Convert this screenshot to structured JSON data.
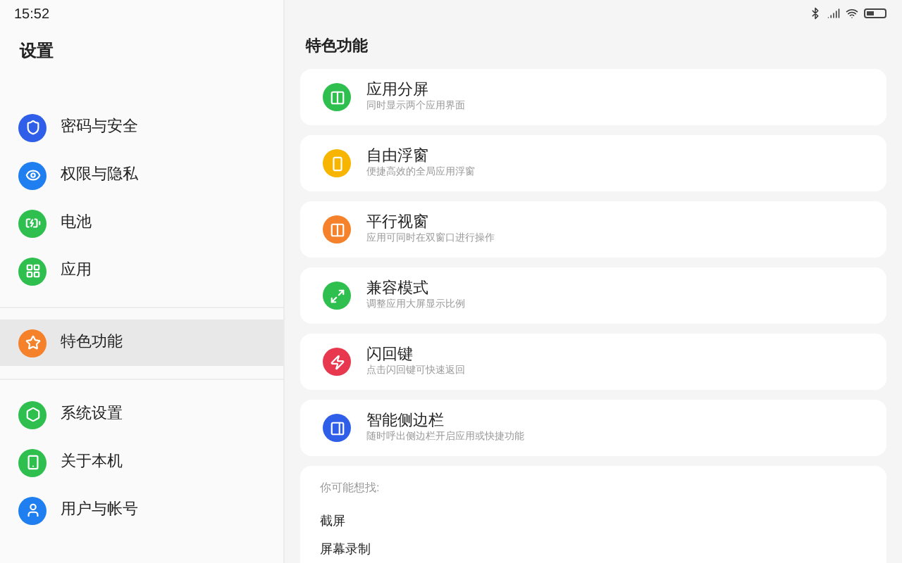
{
  "status_bar": {
    "time": "15:52"
  },
  "sidebar": {
    "title": "设置",
    "groups": [
      {
        "items": [
          {
            "label": "密码与安全",
            "color": "#2f5ee8",
            "selected": false
          },
          {
            "label": "权限与隐私",
            "color": "#1f7ef0",
            "selected": false
          },
          {
            "label": "电池",
            "color": "#2fbf4f",
            "selected": false
          },
          {
            "label": "应用",
            "color": "#2fbf4f",
            "selected": false
          }
        ]
      },
      {
        "items": [
          {
            "label": "特色功能",
            "color": "#f5822a",
            "selected": true
          }
        ]
      },
      {
        "items": [
          {
            "label": "系统设置",
            "color": "#2fbf4f",
            "selected": false
          },
          {
            "label": "关于本机",
            "color": "#2fbf4f",
            "selected": false
          },
          {
            "label": "用户与帐号",
            "color": "#1f7ef0",
            "selected": false
          }
        ]
      }
    ]
  },
  "content": {
    "title": "特色功能",
    "features": [
      {
        "title": "应用分屏",
        "subtitle": "同时显示两个应用界面",
        "color": "#2fbf4f"
      },
      {
        "title": "自由浮窗",
        "subtitle": "便捷高效的全局应用浮窗",
        "color": "#f7b500"
      },
      {
        "title": "平行视窗",
        "subtitle": "应用可同时在双窗口进行操作",
        "color": "#f5822a"
      },
      {
        "title": "兼容模式",
        "subtitle": "调整应用大屏显示比例",
        "color": "#2fbf4f"
      },
      {
        "title": "闪回键",
        "subtitle": "点击闪回键可快速返回",
        "color": "#e8384f"
      },
      {
        "title": "智能侧边栏",
        "subtitle": "随时呼出侧边栏开启应用或快捷功能",
        "color": "#2f5ee8"
      }
    ],
    "suggestions": {
      "heading": "你可能想找:",
      "items": [
        "截屏",
        "屏幕录制"
      ]
    }
  }
}
